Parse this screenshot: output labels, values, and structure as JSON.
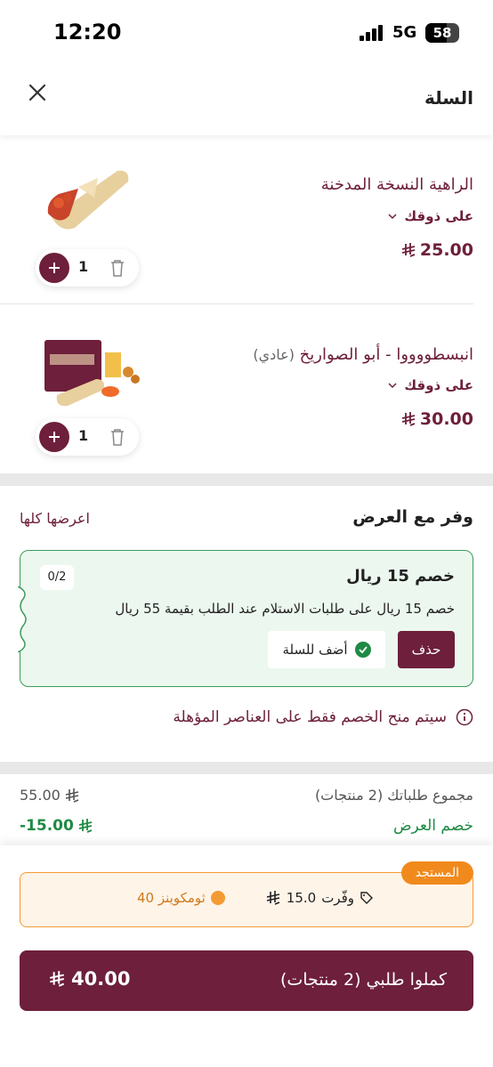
{
  "status": {
    "time": "12:20",
    "network": "5G",
    "battery": "58"
  },
  "header": {
    "title": "السلة"
  },
  "items": [
    {
      "name": "الراهية النسخة المدخنة",
      "note": "",
      "option": "على ذوقك",
      "price": "25.00",
      "quantity": "1"
    },
    {
      "name": "انبسطووووا - أبو الصواريخ",
      "note": "(عادي)",
      "option": "على ذوقك",
      "price": "30.00",
      "quantity": "1"
    }
  ],
  "offers": {
    "title": "وفر مع العرض",
    "view_all": "اعرضها كلها",
    "card": {
      "counter": "0/2",
      "title": "خصم 15 ريال",
      "description": "خصم 15 ريال على طلبات الاستلام عند الطلب بقيمة 55 ريال",
      "delete_label": "حذف",
      "add_label": "أضف للسلة"
    },
    "info": "سيتم منح الخصم فقط على العناصر المؤهلة"
  },
  "summary": {
    "subtotal_label": "مجموع طلباتك (2 منتجات)",
    "subtotal_value": "55.00",
    "discount_label": "خصم العرض",
    "discount_value": "-15.00"
  },
  "rewards": {
    "badge": "المستجد",
    "saved_label": "وفّرت",
    "saved_value": "15.0",
    "coins": "40 ثومكوينز"
  },
  "checkout": {
    "label": "كملوا طلبي (2 منتجات)",
    "total": "40.00"
  },
  "colors": {
    "brand": "#6d1f3b",
    "success": "#1f8a44",
    "accent": "#f18a1c"
  }
}
